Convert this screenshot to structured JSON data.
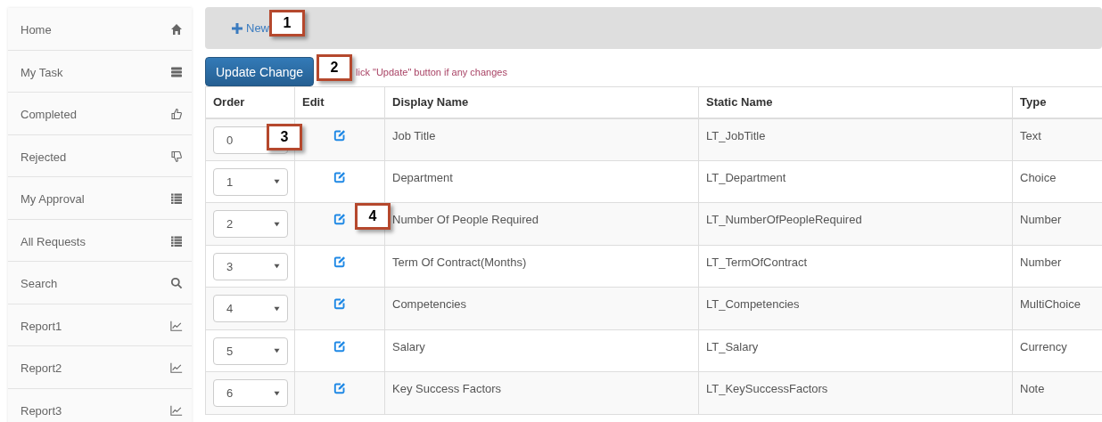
{
  "sidebar": {
    "items": [
      {
        "label": "Home"
      },
      {
        "label": "My Task"
      },
      {
        "label": "Completed"
      },
      {
        "label": "Rejected"
      },
      {
        "label": "My Approval"
      },
      {
        "label": "All Requests"
      },
      {
        "label": "Search"
      },
      {
        "label": "Report1"
      },
      {
        "label": "Report2"
      },
      {
        "label": "Report3"
      }
    ]
  },
  "toolbar": {
    "new_button": "New"
  },
  "update_button": "Update Change",
  "hint": "lick \"Update\" button if any changes",
  "table": {
    "columns": [
      "Order",
      "Edit",
      "Display Name",
      "Static Name",
      "Type"
    ],
    "rows": [
      {
        "kind": "input",
        "order": "0",
        "display_name": "Job Title",
        "static_name": "LT_JobTitle",
        "type": "Text"
      },
      {
        "kind": "select",
        "order": "1",
        "display_name": "Department",
        "static_name": "LT_Department",
        "type": "Choice"
      },
      {
        "kind": "select",
        "order": "2",
        "display_name": "Number Of People Required",
        "static_name": "LT_NumberOfPeopleRequired",
        "type": "Number"
      },
      {
        "kind": "select",
        "order": "3",
        "display_name": "Term Of Contract(Months)",
        "static_name": "LT_TermOfContract",
        "type": "Number"
      },
      {
        "kind": "select",
        "order": "4",
        "display_name": "Competencies",
        "static_name": "LT_Competencies",
        "type": "MultiChoice"
      },
      {
        "kind": "select",
        "order": "5",
        "display_name": "Salary",
        "static_name": "LT_Salary",
        "type": "Currency"
      },
      {
        "kind": "select",
        "order": "6",
        "display_name": "Key Success Factors",
        "static_name": "LT_KeySuccessFactors",
        "type": "Note"
      }
    ]
  },
  "annotations": [
    {
      "label": "1"
    },
    {
      "label": "2"
    },
    {
      "label": "3"
    },
    {
      "label": "4"
    }
  ]
}
